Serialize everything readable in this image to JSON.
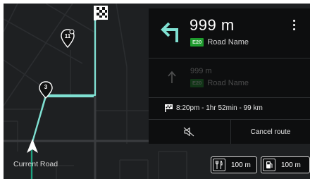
{
  "colors": {
    "map_background": "#1e2022",
    "road": "#2a2c2e",
    "route": "#7fe0d2",
    "panel": "#0d0e0f",
    "route_shield": "#1e9b2d"
  },
  "map": {
    "current_road": "Current Road",
    "waypoint_pins": [
      {
        "label": "11",
        "icon": "map-pin-icon"
      },
      {
        "label": "3",
        "icon": "map-pin-icon"
      }
    ],
    "destination_icon": "checkered-flag-icon",
    "vehicle_icon": "navigation-arrow-icon"
  },
  "maneuver": {
    "current": {
      "icon": "turn-left-icon",
      "distance": "999 m",
      "shield": "E20",
      "road_name": "Road Name"
    },
    "next": {
      "icon": "straight-arrow-icon",
      "distance": "999 m",
      "shield": "E20",
      "road_name": "Road Name"
    }
  },
  "menu_icon": "more-vertical-icon",
  "trip": {
    "icon": "checkered-flag-icon",
    "summary": "8:20pm  -  1hr 52min  -  99 km"
  },
  "actions": {
    "mute_icon": "sound-off-icon",
    "cancel_label": "Cancel route"
  },
  "poi": [
    {
      "icon": "fork-knife-icon",
      "distance": "100 m"
    },
    {
      "icon": "fuel-pump-icon",
      "distance": "100 m"
    }
  ]
}
